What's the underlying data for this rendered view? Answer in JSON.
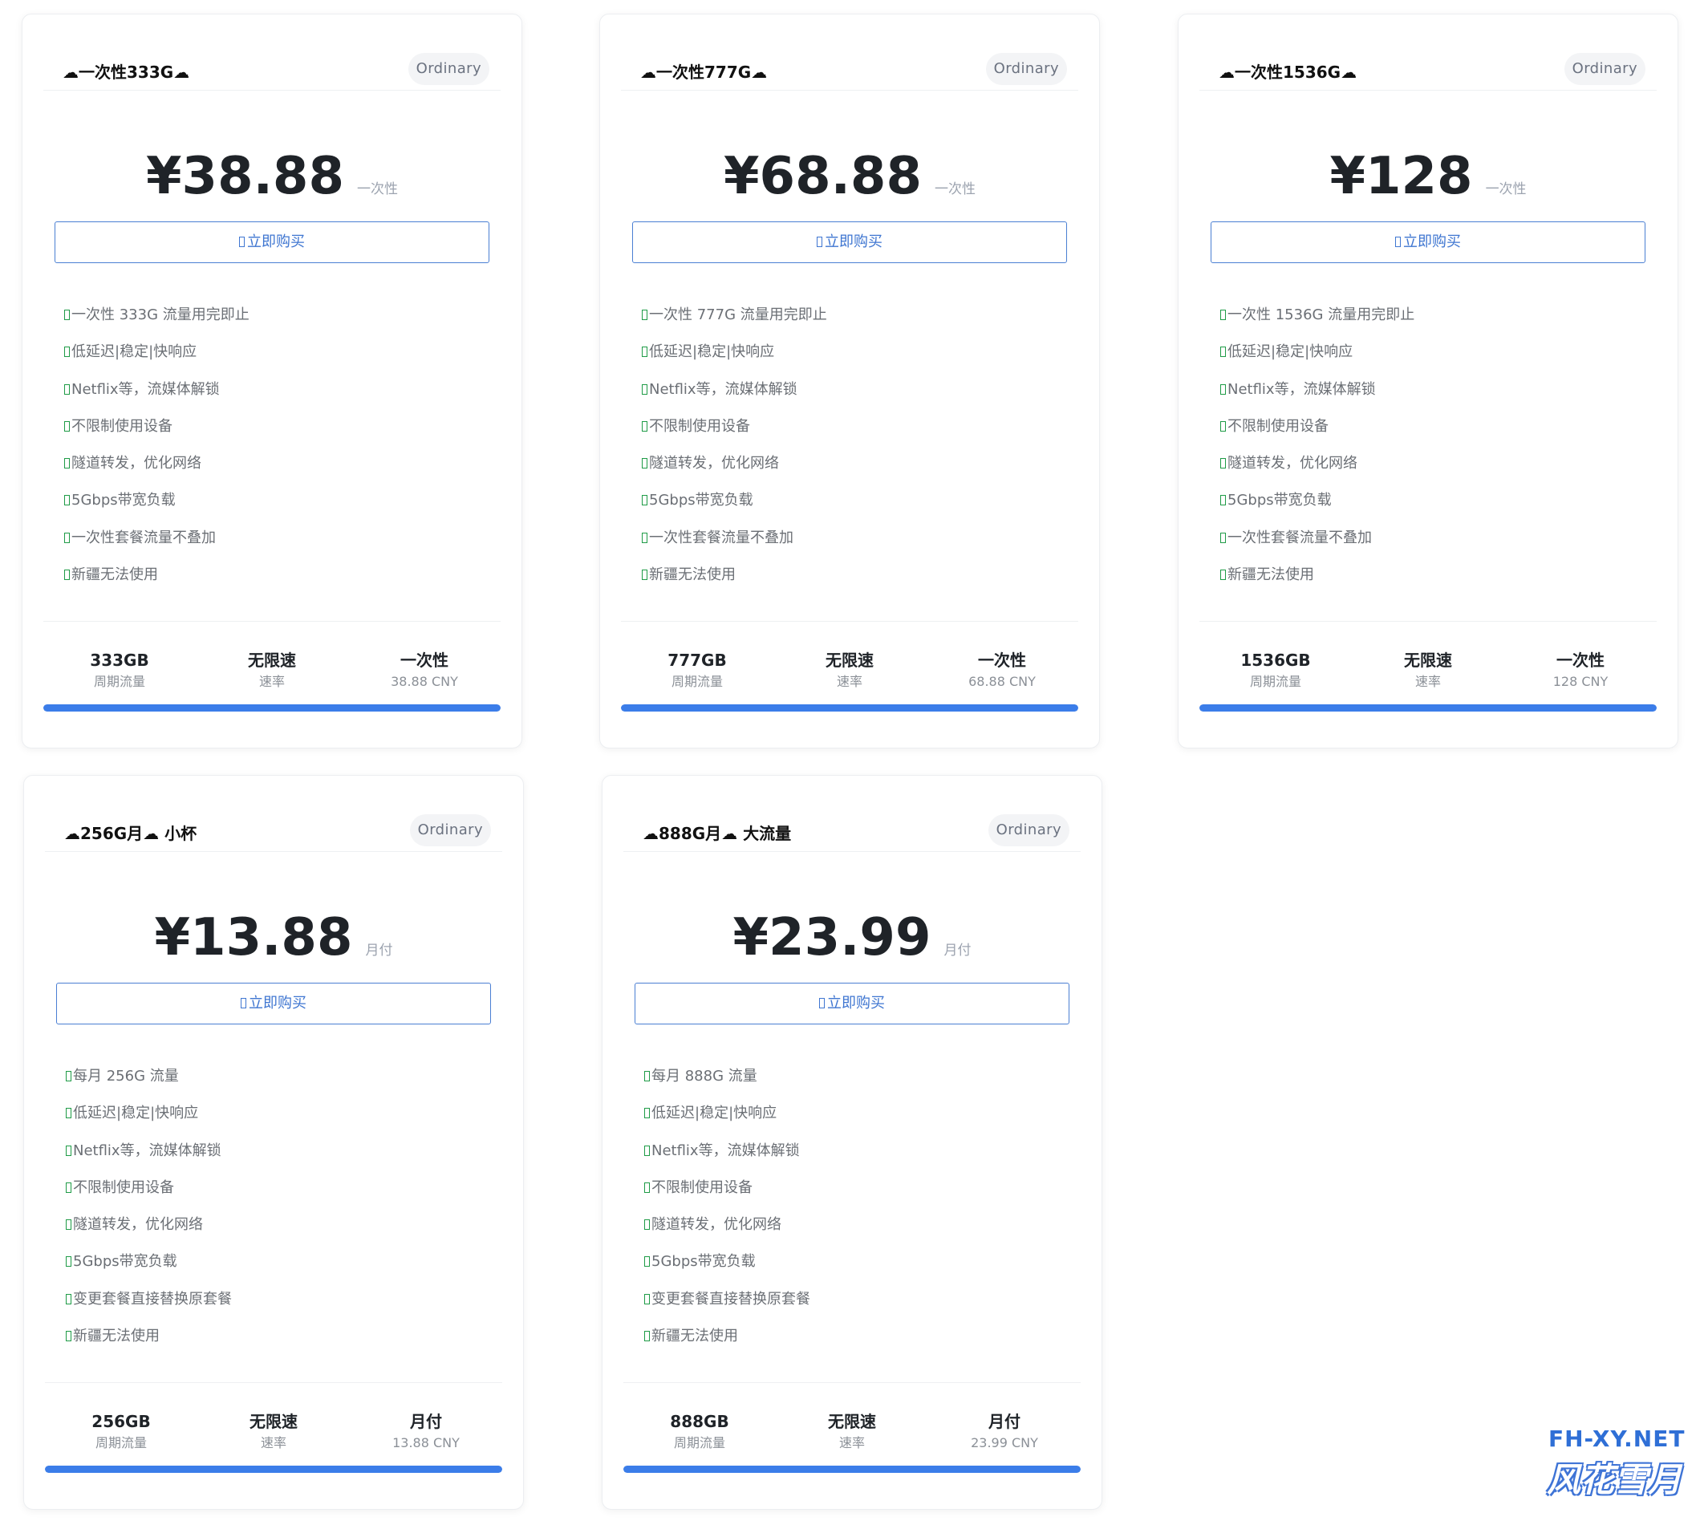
{
  "plans": [
    {
      "name": "☁一次性333G☁",
      "badge": "Ordinary",
      "price": "¥38.88",
      "period": "一次性",
      "buy_label": "立即购买",
      "features": [
        "一次性 333G 流量用完即止",
        "低延迟|稳定|快响应",
        "Netflix等，流媒体解锁",
        "不限制使用设备",
        "隧道转发，优化网络",
        "5Gbps带宽负载",
        "一次性套餐流量不叠加",
        "新疆无法使用"
      ],
      "stats": [
        {
          "value": "333GB",
          "label": "周期流量"
        },
        {
          "value": "无限速",
          "label": "速率"
        },
        {
          "value": "一次性",
          "label": "38.88 CNY"
        }
      ],
      "progress": 1.0
    },
    {
      "name": "☁一次性777G☁",
      "badge": "Ordinary",
      "price": "¥68.88",
      "period": "一次性",
      "buy_label": "立即购买",
      "features": [
        "一次性 777G 流量用完即止",
        "低延迟|稳定|快响应",
        "Netflix等，流媒体解锁",
        "不限制使用设备",
        "隧道转发，优化网络",
        "5Gbps带宽负载",
        "一次性套餐流量不叠加",
        "新疆无法使用"
      ],
      "stats": [
        {
          "value": "777GB",
          "label": "周期流量"
        },
        {
          "value": "无限速",
          "label": "速率"
        },
        {
          "value": "一次性",
          "label": "68.88 CNY"
        }
      ],
      "progress": 1.0
    },
    {
      "name": "☁一次性1536G☁",
      "badge": "Ordinary",
      "price": "¥128",
      "period": "一次性",
      "buy_label": "立即购买",
      "features": [
        "一次性 1536G 流量用完即止",
        "低延迟|稳定|快响应",
        "Netflix等，流媒体解锁",
        "不限制使用设备",
        "隧道转发，优化网络",
        "5Gbps带宽负载",
        "一次性套餐流量不叠加",
        "新疆无法使用"
      ],
      "stats": [
        {
          "value": "1536GB",
          "label": "周期流量"
        },
        {
          "value": "无限速",
          "label": "速率"
        },
        {
          "value": "一次性",
          "label": "128 CNY"
        }
      ],
      "progress": 1.0
    },
    {
      "name": "☁256G月☁ 小杯",
      "badge": "Ordinary",
      "price": "¥13.88",
      "period": "月付",
      "buy_label": "立即购买",
      "features": [
        "每月 256G 流量",
        "低延迟|稳定|快响应",
        "Netflix等，流媒体解锁",
        "不限制使用设备",
        "隧道转发，优化网络",
        "5Gbps带宽负载",
        "变更套餐直接替换原套餐",
        "新疆无法使用"
      ],
      "stats": [
        {
          "value": "256GB",
          "label": "周期流量"
        },
        {
          "value": "无限速",
          "label": "速率"
        },
        {
          "value": "月付",
          "label": "13.88 CNY"
        }
      ],
      "progress": 1.0
    },
    {
      "name": "☁888G月☁ 大流量",
      "badge": "Ordinary",
      "price": "¥23.99",
      "period": "月付",
      "buy_label": "立即购买",
      "features": [
        "每月 888G 流量",
        "低延迟|稳定|快响应",
        "Netflix等，流媒体解锁",
        "不限制使用设备",
        "隧道转发，优化网络",
        "5Gbps带宽负载",
        "变更套餐直接替换原套餐",
        "新疆无法使用"
      ],
      "stats": [
        {
          "value": "888GB",
          "label": "周期流量"
        },
        {
          "value": "无限速",
          "label": "速率"
        },
        {
          "value": "月付",
          "label": "23.99 CNY"
        }
      ],
      "progress": 1.0
    }
  ],
  "colors": {
    "accent": "#3b7de9",
    "feature_icon": "#1e9b46",
    "badge_bg": "#f3f4f6"
  },
  "icons": {
    "buy": "cart-icon",
    "feature": "check-icon"
  },
  "watermark": {
    "domain": "FH-XY.NET",
    "brand": "风花雪月"
  }
}
